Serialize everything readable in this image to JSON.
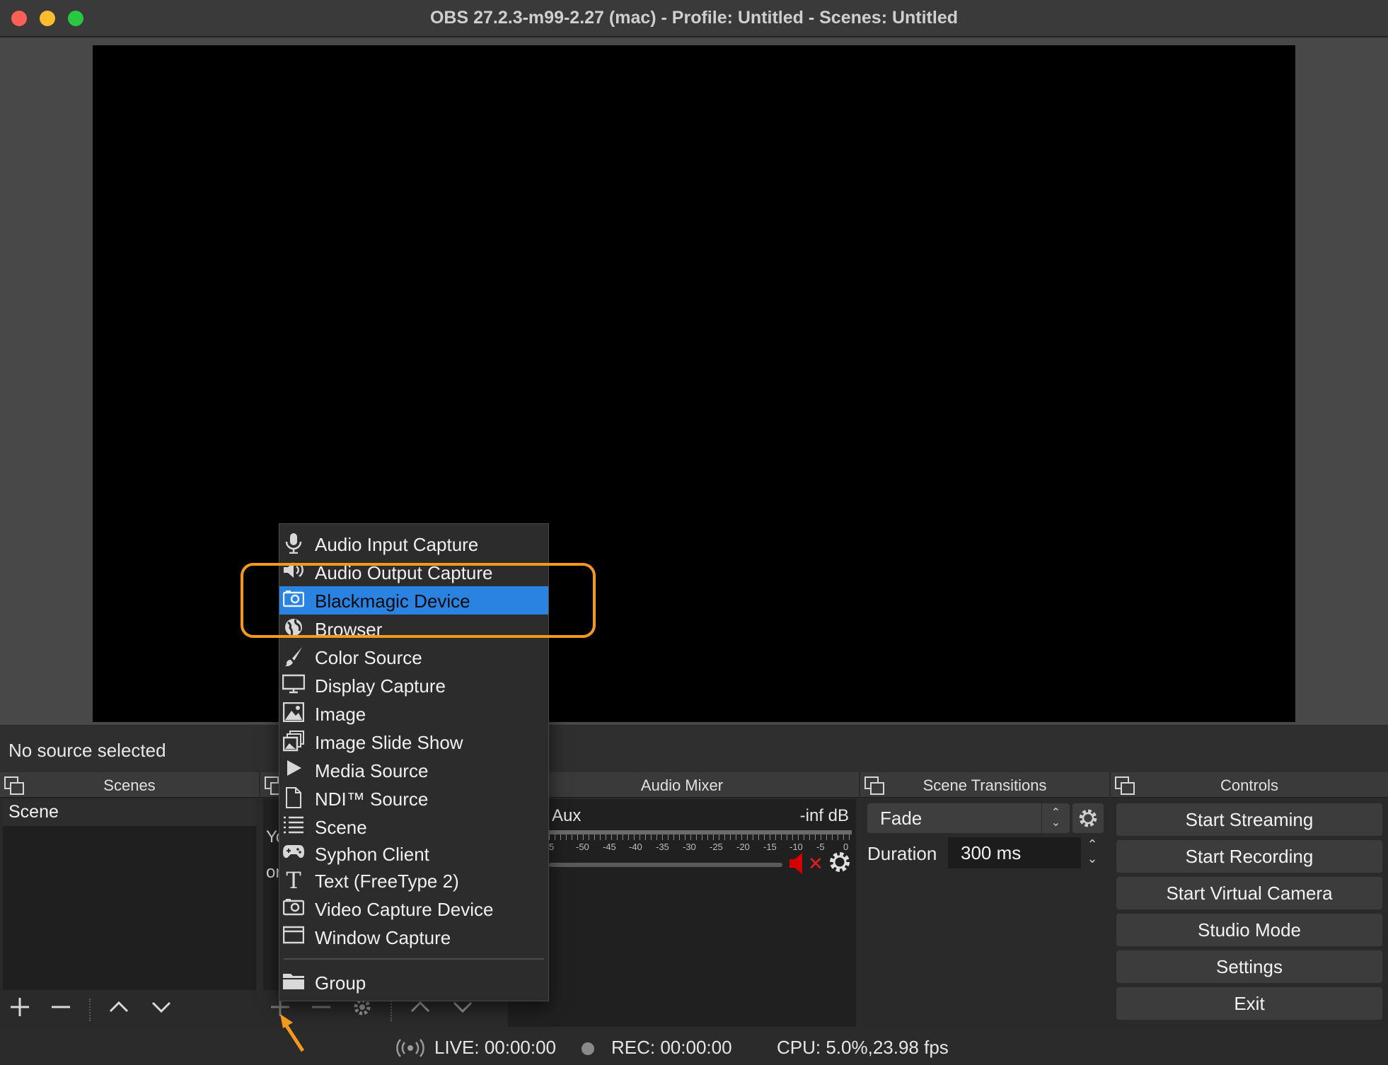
{
  "window": {
    "title": "OBS 27.2.3-m99-2.27 (mac) - Profile: Untitled - Scenes: Untitled"
  },
  "source_status": "No source selected",
  "scenes": {
    "title": "Scenes",
    "items": [
      "Scene"
    ],
    "toolbar": [
      "+",
      "−",
      "^",
      "v"
    ]
  },
  "sources": {
    "partial_text_1": "Yo",
    "partial_text_2": "or"
  },
  "audio_mixer": {
    "title": "Audio Mixer",
    "channel": "Aux",
    "level": "-inf dB",
    "scale": [
      "5",
      "-50",
      "-45",
      "-40",
      "-35",
      "-30",
      "-25",
      "-20",
      "-15",
      "-10",
      "-5",
      "0"
    ],
    "muted": true
  },
  "scene_transitions": {
    "title": "Scene Transitions",
    "selected": "Fade",
    "duration_label": "Duration",
    "duration_value": "300 ms"
  },
  "controls": {
    "title": "Controls",
    "buttons": [
      "Start Streaming",
      "Start Recording",
      "Start Virtual Camera",
      "Studio Mode",
      "Settings",
      "Exit"
    ]
  },
  "status": {
    "live": "LIVE: 00:00:00",
    "rec": "REC: 00:00:00",
    "cpu": "CPU: 5.0%,23.98 fps"
  },
  "menu": {
    "items": [
      {
        "label": "Audio Input Capture",
        "icon": "microphone-icon"
      },
      {
        "label": "Audio Output Capture",
        "icon": "speaker-icon"
      },
      {
        "label": "Blackmagic Device",
        "icon": "camera-icon",
        "highlighted": true
      },
      {
        "label": "Browser",
        "icon": "globe-icon"
      },
      {
        "label": "Color Source",
        "icon": "brush-icon"
      },
      {
        "label": "Display Capture",
        "icon": "monitor-icon"
      },
      {
        "label": "Image",
        "icon": "image-icon"
      },
      {
        "label": "Image Slide Show",
        "icon": "slideshow-icon"
      },
      {
        "label": "Media Source",
        "icon": "play-icon"
      },
      {
        "label": "NDI™ Source",
        "icon": "document-icon"
      },
      {
        "label": "Scene",
        "icon": "list-icon"
      },
      {
        "label": "Syphon Client",
        "icon": "gamepad-icon"
      },
      {
        "label": "Text (FreeType 2)",
        "icon": "text-icon"
      },
      {
        "label": "Video Capture Device",
        "icon": "camera-icon"
      },
      {
        "label": "Window Capture",
        "icon": "window-icon"
      },
      {
        "label": "Group",
        "icon": "folder-icon"
      }
    ]
  },
  "colors": {
    "menu_highlight": "#2a83e0",
    "annotation": "#f39a1c",
    "mute": "#d40000"
  }
}
